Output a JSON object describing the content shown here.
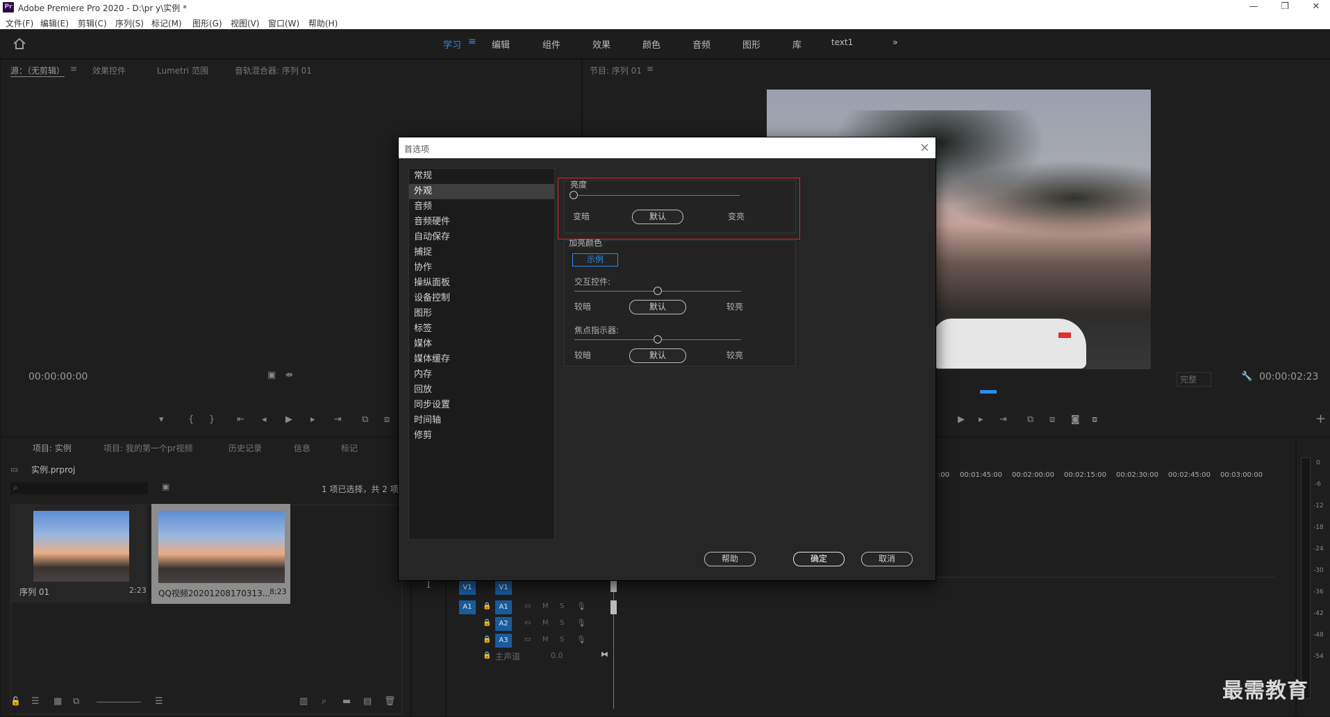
{
  "window": {
    "app_icon": "Pr",
    "title": "Adobe Premiere Pro 2020 - D:\\pr y\\实例 *"
  },
  "menubar": [
    "文件(F)",
    "编辑(E)",
    "剪辑(C)",
    "序列(S)",
    "标记(M)",
    "图形(G)",
    "视图(V)",
    "窗口(W)",
    "帮助(H)"
  ],
  "workspaces": {
    "items": [
      "学习",
      "编辑",
      "组件",
      "效果",
      "颜色",
      "音频",
      "图形",
      "库",
      "text1"
    ],
    "active": "学习",
    "more": "»"
  },
  "source_panel": {
    "tabs": [
      "源：（无剪辑）",
      "效果控件",
      "Lumetri 范围",
      "音轨混合器: 序列 01"
    ],
    "timecode": "00:00:00:00"
  },
  "program_panel": {
    "tab": "节目: 序列 01",
    "fit_label": "完整",
    "timecode": "00:00:02:23"
  },
  "project_panel": {
    "tabs": [
      "项目: 实例",
      "项目: 我的第一个pr视频",
      "历史记录",
      "信息",
      "标记"
    ],
    "project_file": "实例.prproj",
    "selection_info": "1 项已选择，共 2 项",
    "items": [
      {
        "name": "序列 01",
        "duration": "2:23"
      },
      {
        "name": "QQ视频20201208170313...",
        "duration": "8;23"
      }
    ]
  },
  "timeline": {
    "ruler": [
      ":00",
      "00:01:45:00",
      "00:02:00:00",
      "00:02:15:00",
      "00:02:30:00",
      "00:02:45:00",
      "00:03:00:00"
    ],
    "tracks": [
      {
        "patch": "V1",
        "name": "V1"
      },
      {
        "patch": "A1",
        "name": "A1",
        "m": "M",
        "s": "S"
      },
      {
        "patch": "",
        "name": "A2",
        "m": "M",
        "s": "S"
      },
      {
        "patch": "",
        "name": "A3",
        "m": "M",
        "s": "S"
      }
    ],
    "master": {
      "name": "主声道",
      "value": "0.0"
    },
    "meter_scale": [
      "0",
      "-6",
      "-12",
      "-18",
      "-24",
      "-30",
      "-36",
      "-42",
      "-48",
      "-54"
    ]
  },
  "dialog": {
    "title": "首选项",
    "categories": [
      "常规",
      "外观",
      "音频",
      "音频硬件",
      "自动保存",
      "捕捉",
      "协作",
      "操纵面板",
      "设备控制",
      "图形",
      "标签",
      "媒体",
      "媒体缓存",
      "内存",
      "回放",
      "同步设置",
      "时间轴",
      "修剪"
    ],
    "selected_category": "外观",
    "brightness": {
      "title": "亮度",
      "left": "变暗",
      "default": "默认",
      "right": "变亮",
      "value_fraction": 0.0
    },
    "highlight_color": {
      "title": "加亮颜色",
      "sample": "示例",
      "interactive": {
        "label": "交互控件:",
        "left": "较暗",
        "default": "默认",
        "right": "较亮",
        "value_fraction": 0.5
      },
      "focus": {
        "label": "焦点指示器:",
        "left": "较暗",
        "default": "默认",
        "right": "较亮",
        "value_fraction": 0.5
      }
    },
    "buttons": {
      "help": "帮助",
      "ok": "确定",
      "cancel": "取消"
    }
  },
  "watermark": "最需教育",
  "colors": {
    "accent": "#2d8ceb",
    "highlight_box": "#e0262a",
    "track_patch": "#1a5c9c"
  }
}
